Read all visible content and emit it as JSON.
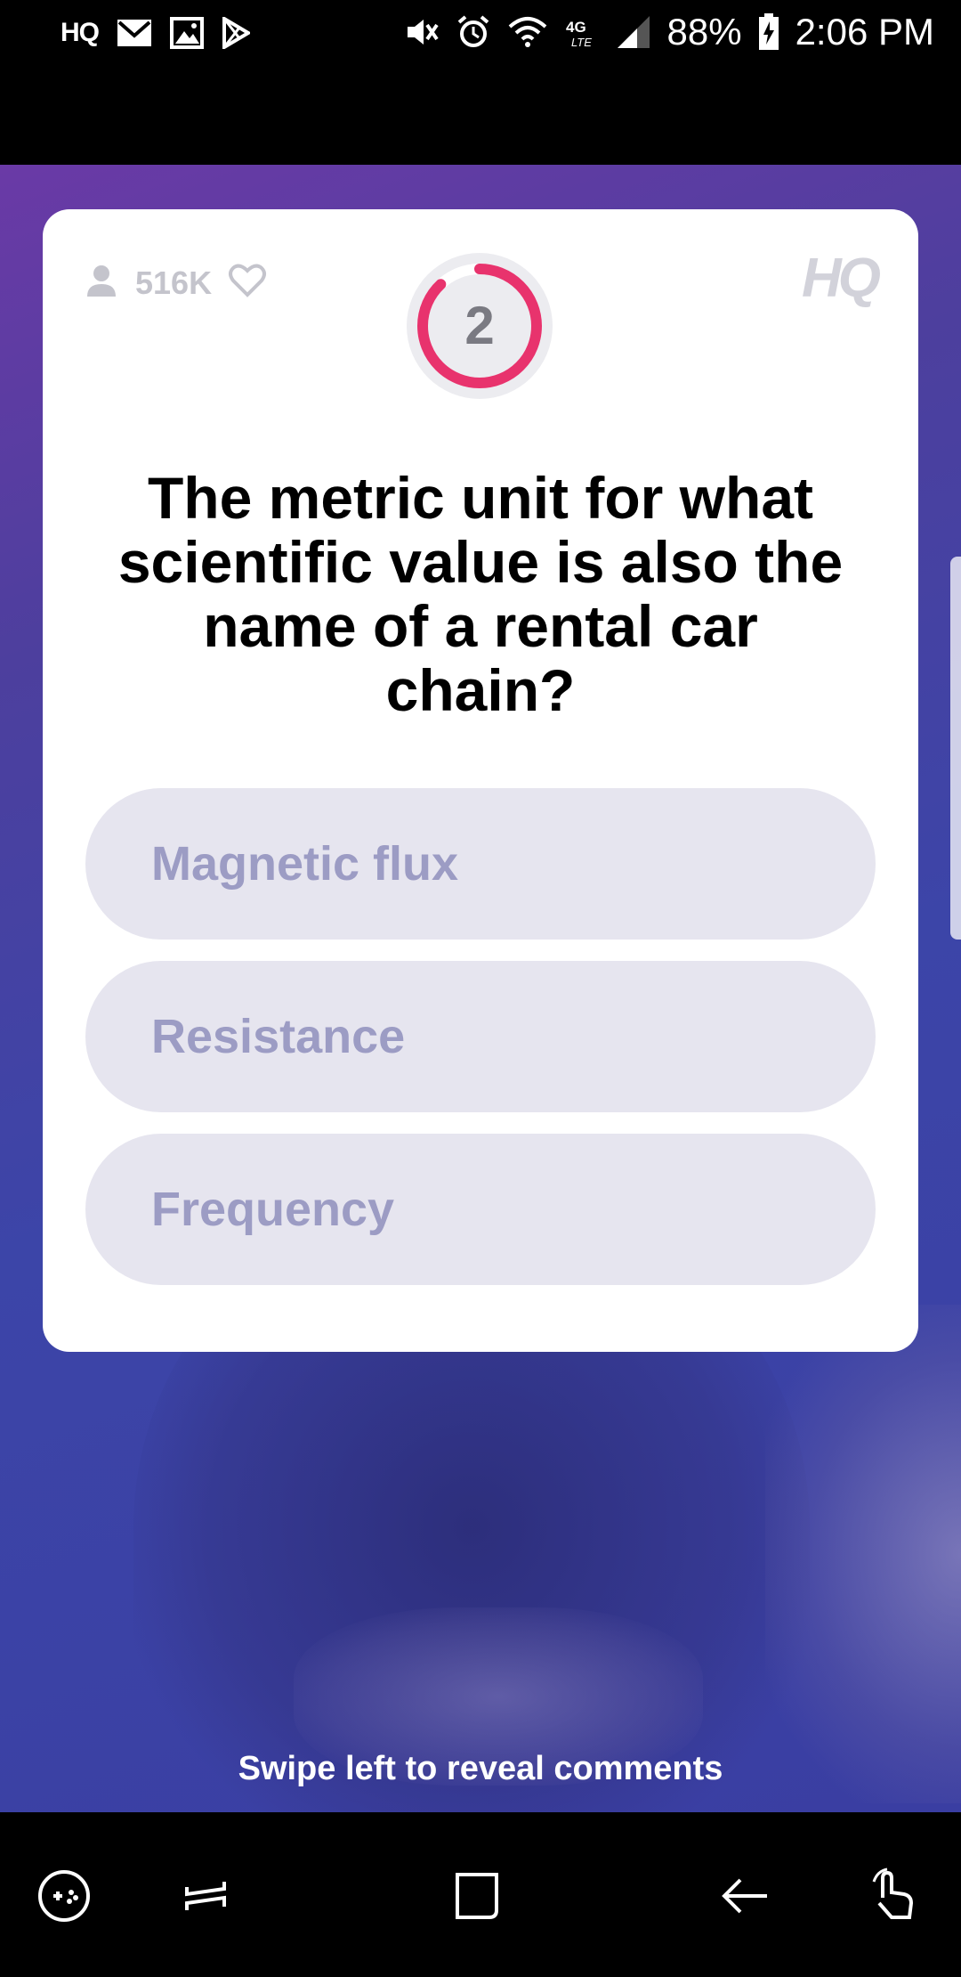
{
  "status_bar": {
    "app_icons": [
      "hq-app-icon",
      "mail-icon",
      "image-icon",
      "play-store-icon"
    ],
    "hq_label": "HQ",
    "network": "4G LTE",
    "battery": "88%",
    "time": "2:06 PM"
  },
  "game": {
    "viewers": "516K",
    "logo": "HQ",
    "question_number": "2",
    "timer_fraction": 0.88,
    "question": "The metric unit for what scientific value is also the name of a rental car chain?",
    "answers": [
      "Magnetic flux",
      "Resistance",
      "Frequency"
    ],
    "swipe_hint": "Swipe left to reveal comments"
  },
  "colors": {
    "timer_ring": "#e8336d",
    "answer_bg": "#e6e5ef",
    "answer_text": "#9c9cc4"
  },
  "nav_bar": {
    "icons": [
      "game-tools-icon",
      "recent-apps-icon",
      "home-icon",
      "back-icon",
      "touch-assist-icon"
    ]
  }
}
